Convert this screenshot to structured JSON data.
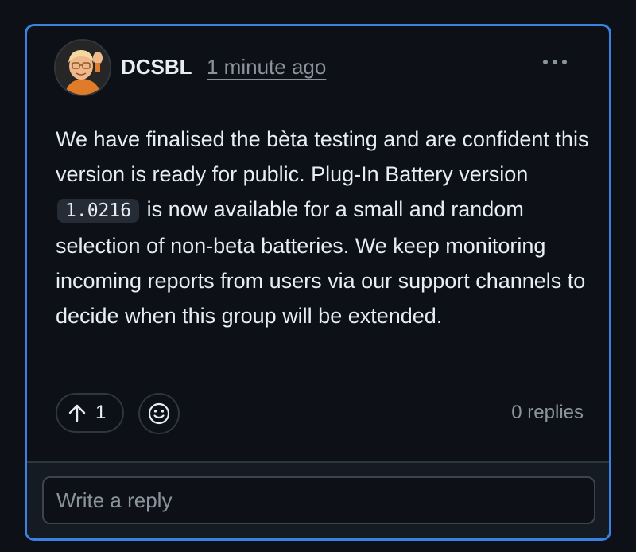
{
  "comment": {
    "author": "DCSBL",
    "timestamp": "1 minute ago",
    "body": {
      "part1": "We have finalised the bèta testing and are confident this version is ready for public. Plug-In Battery version ",
      "code": "1.0216",
      "part2": " is now available for a small and random selection of non-beta batteries. We keep monitoring incoming reports from users via our support channels to decide when this group will be extended."
    }
  },
  "actions": {
    "upvote_icon": "arrow-up-icon",
    "upvote_count": "1",
    "emoji_icon": "smiley-icon",
    "menu_icon": "kebab-horizontal-icon",
    "replies_label": "0 replies"
  },
  "reply": {
    "placeholder": "Write a reply"
  },
  "colors": {
    "accent_border": "#3b82e0",
    "background": "#0d1117",
    "text_primary": "#e6edf3",
    "text_muted": "#8b949e"
  }
}
